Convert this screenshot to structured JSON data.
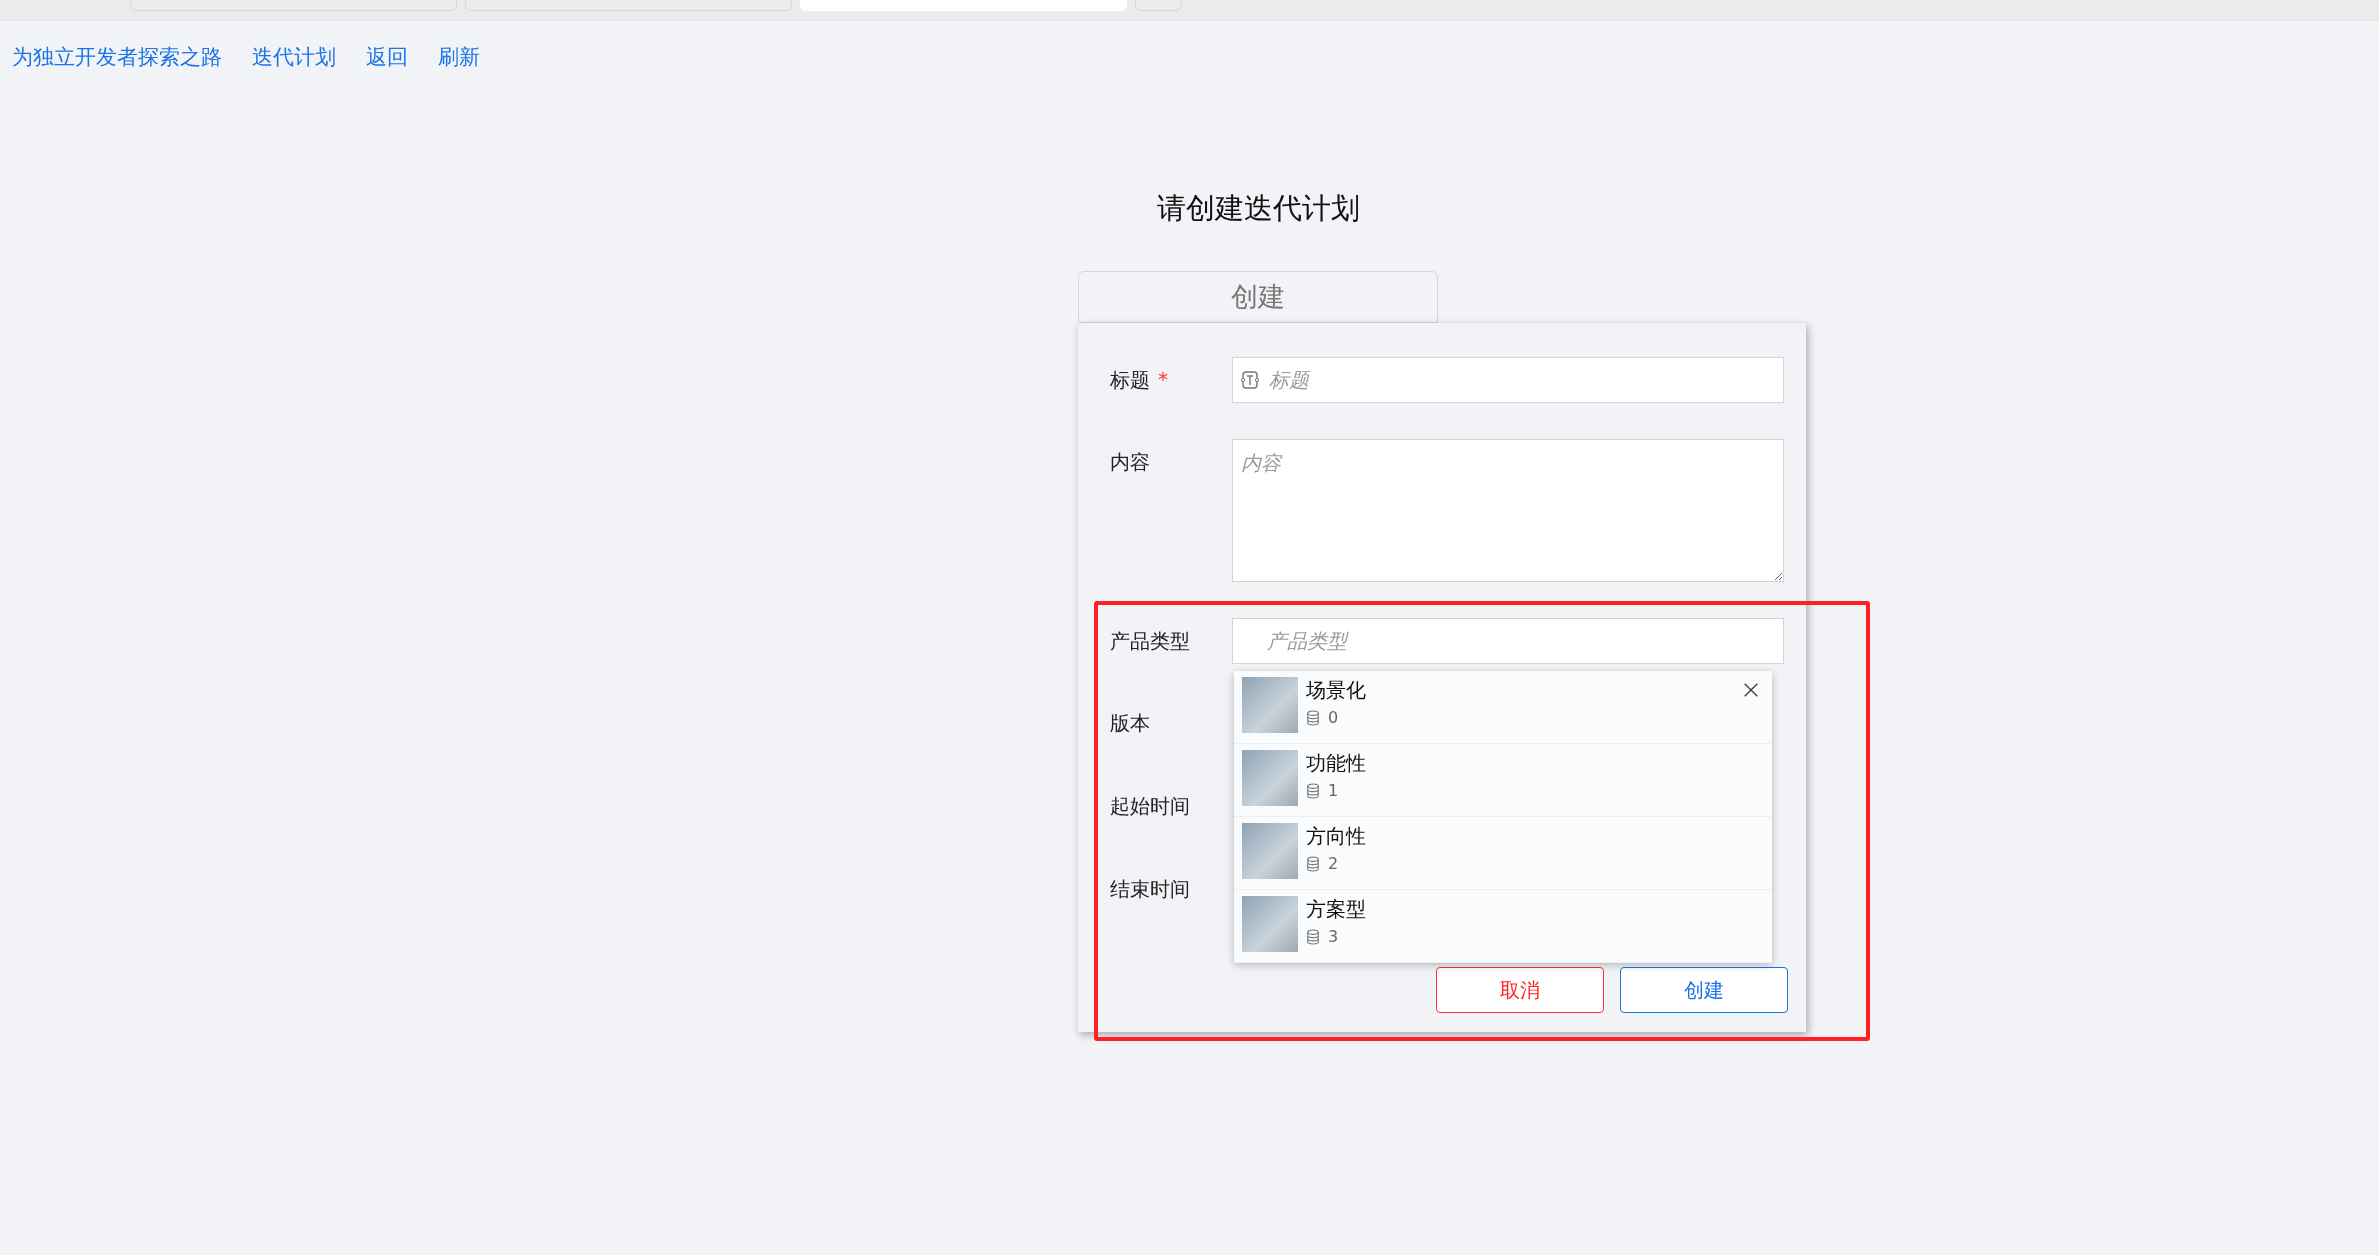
{
  "browser_tabs": [
    {
      "selected": false
    },
    {
      "selected": false
    },
    {
      "selected": true
    },
    {
      "selected": false
    }
  ],
  "nav_links": [
    "为独立开发者探索之路",
    "迭代计划",
    "返回",
    "刷新"
  ],
  "page_title": "请创建迭代计划",
  "create_toggle": "创建",
  "form": {
    "fields": [
      {
        "label": "标题",
        "required_mark": "*",
        "kind": "input",
        "placeholder": "标题"
      },
      {
        "label": "内容",
        "kind": "textarea",
        "placeholder": "内容"
      },
      {
        "label": "产品类型",
        "kind": "select",
        "placeholder": "产品类型"
      },
      {
        "label": "版本",
        "kind": "covered"
      },
      {
        "label": "起始时间",
        "kind": "covered"
      },
      {
        "label": "结束时间",
        "kind": "covered"
      }
    ],
    "dropdown_options": [
      {
        "name": "场景化",
        "count": "0"
      },
      {
        "name": "功能性",
        "count": "1"
      },
      {
        "name": "方向性",
        "count": "2"
      },
      {
        "name": "方案型",
        "count": "3"
      }
    ],
    "buttons": [
      {
        "label": "取消",
        "kind": "cancel"
      },
      {
        "label": "创建",
        "kind": "submit"
      }
    ]
  },
  "annotation": {
    "color": "#ff2020"
  }
}
